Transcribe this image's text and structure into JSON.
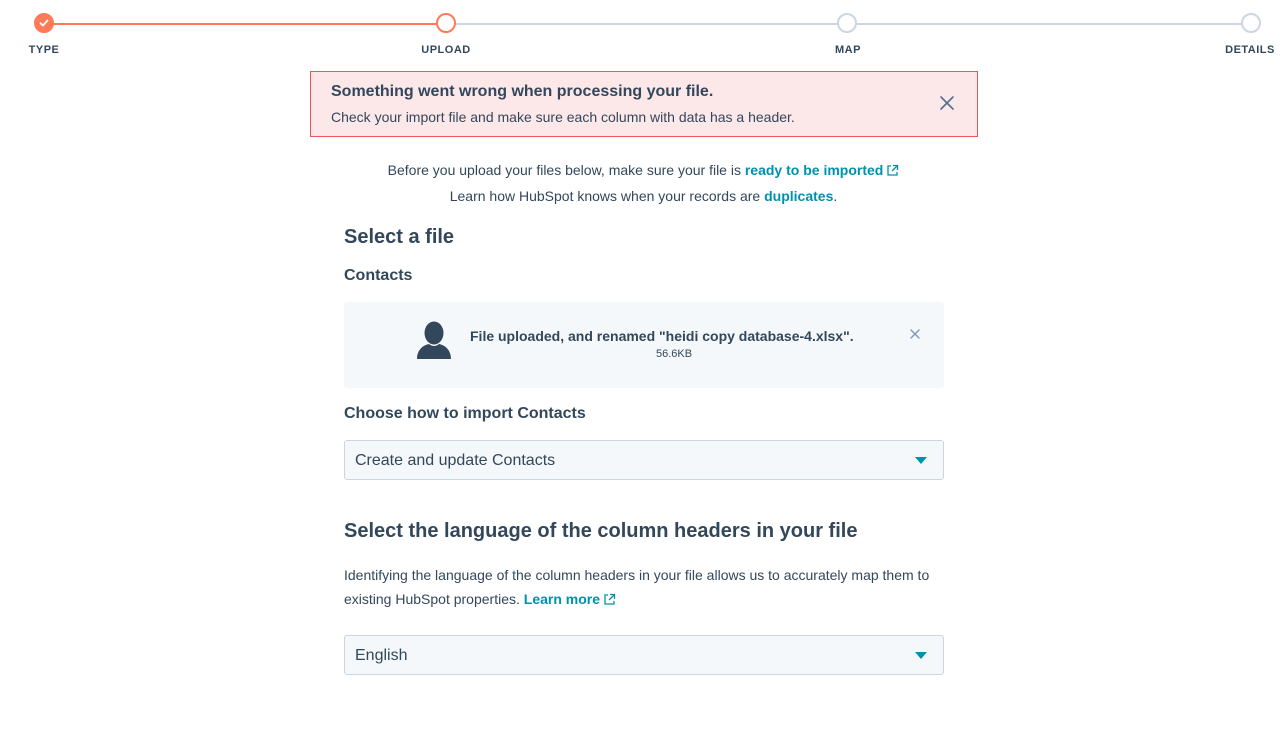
{
  "stepper": {
    "steps": [
      {
        "label": "TYPE",
        "state": "done"
      },
      {
        "label": "UPLOAD",
        "state": "current"
      },
      {
        "label": "MAP",
        "state": "todo"
      },
      {
        "label": "DETAILS",
        "state": "todo"
      }
    ],
    "done_color": "#ff7a59",
    "todo_color": "#cbd6e2"
  },
  "alert": {
    "title": "Something went wrong when processing your file.",
    "message": "Check your import file and make sure each column with data has a header.",
    "close_icon": "close-icon",
    "background": "#fde8e9",
    "border_color": "#f2545b"
  },
  "intro": {
    "line1_prefix": "Before you upload your files below, make sure your file is ",
    "line1_link": "ready to be imported",
    "line2_prefix": "Learn how HubSpot knows when your records are ",
    "line2_link": "duplicates",
    "line2_suffix": "."
  },
  "select_file": {
    "heading": "Select a file",
    "object_label": "Contacts",
    "upload": {
      "message": "File uploaded, and renamed \"heidi copy database-4.xlsx\".",
      "size": "56.6KB",
      "icon": "contact-avatar-icon",
      "remove_icon": "close-icon"
    }
  },
  "import_mode": {
    "label": "Choose how to import Contacts",
    "selected": "Create and update Contacts"
  },
  "language": {
    "heading": "Select the language of the column headers in your file",
    "description": "Identifying the language of the column headers in your file allows us to accurately map them to existing HubSpot properties. ",
    "learn_more": "Learn more",
    "selected": "English"
  },
  "colors": {
    "link": "#0091ae",
    "text": "#33475b",
    "field_bg": "#f5f8fa"
  }
}
